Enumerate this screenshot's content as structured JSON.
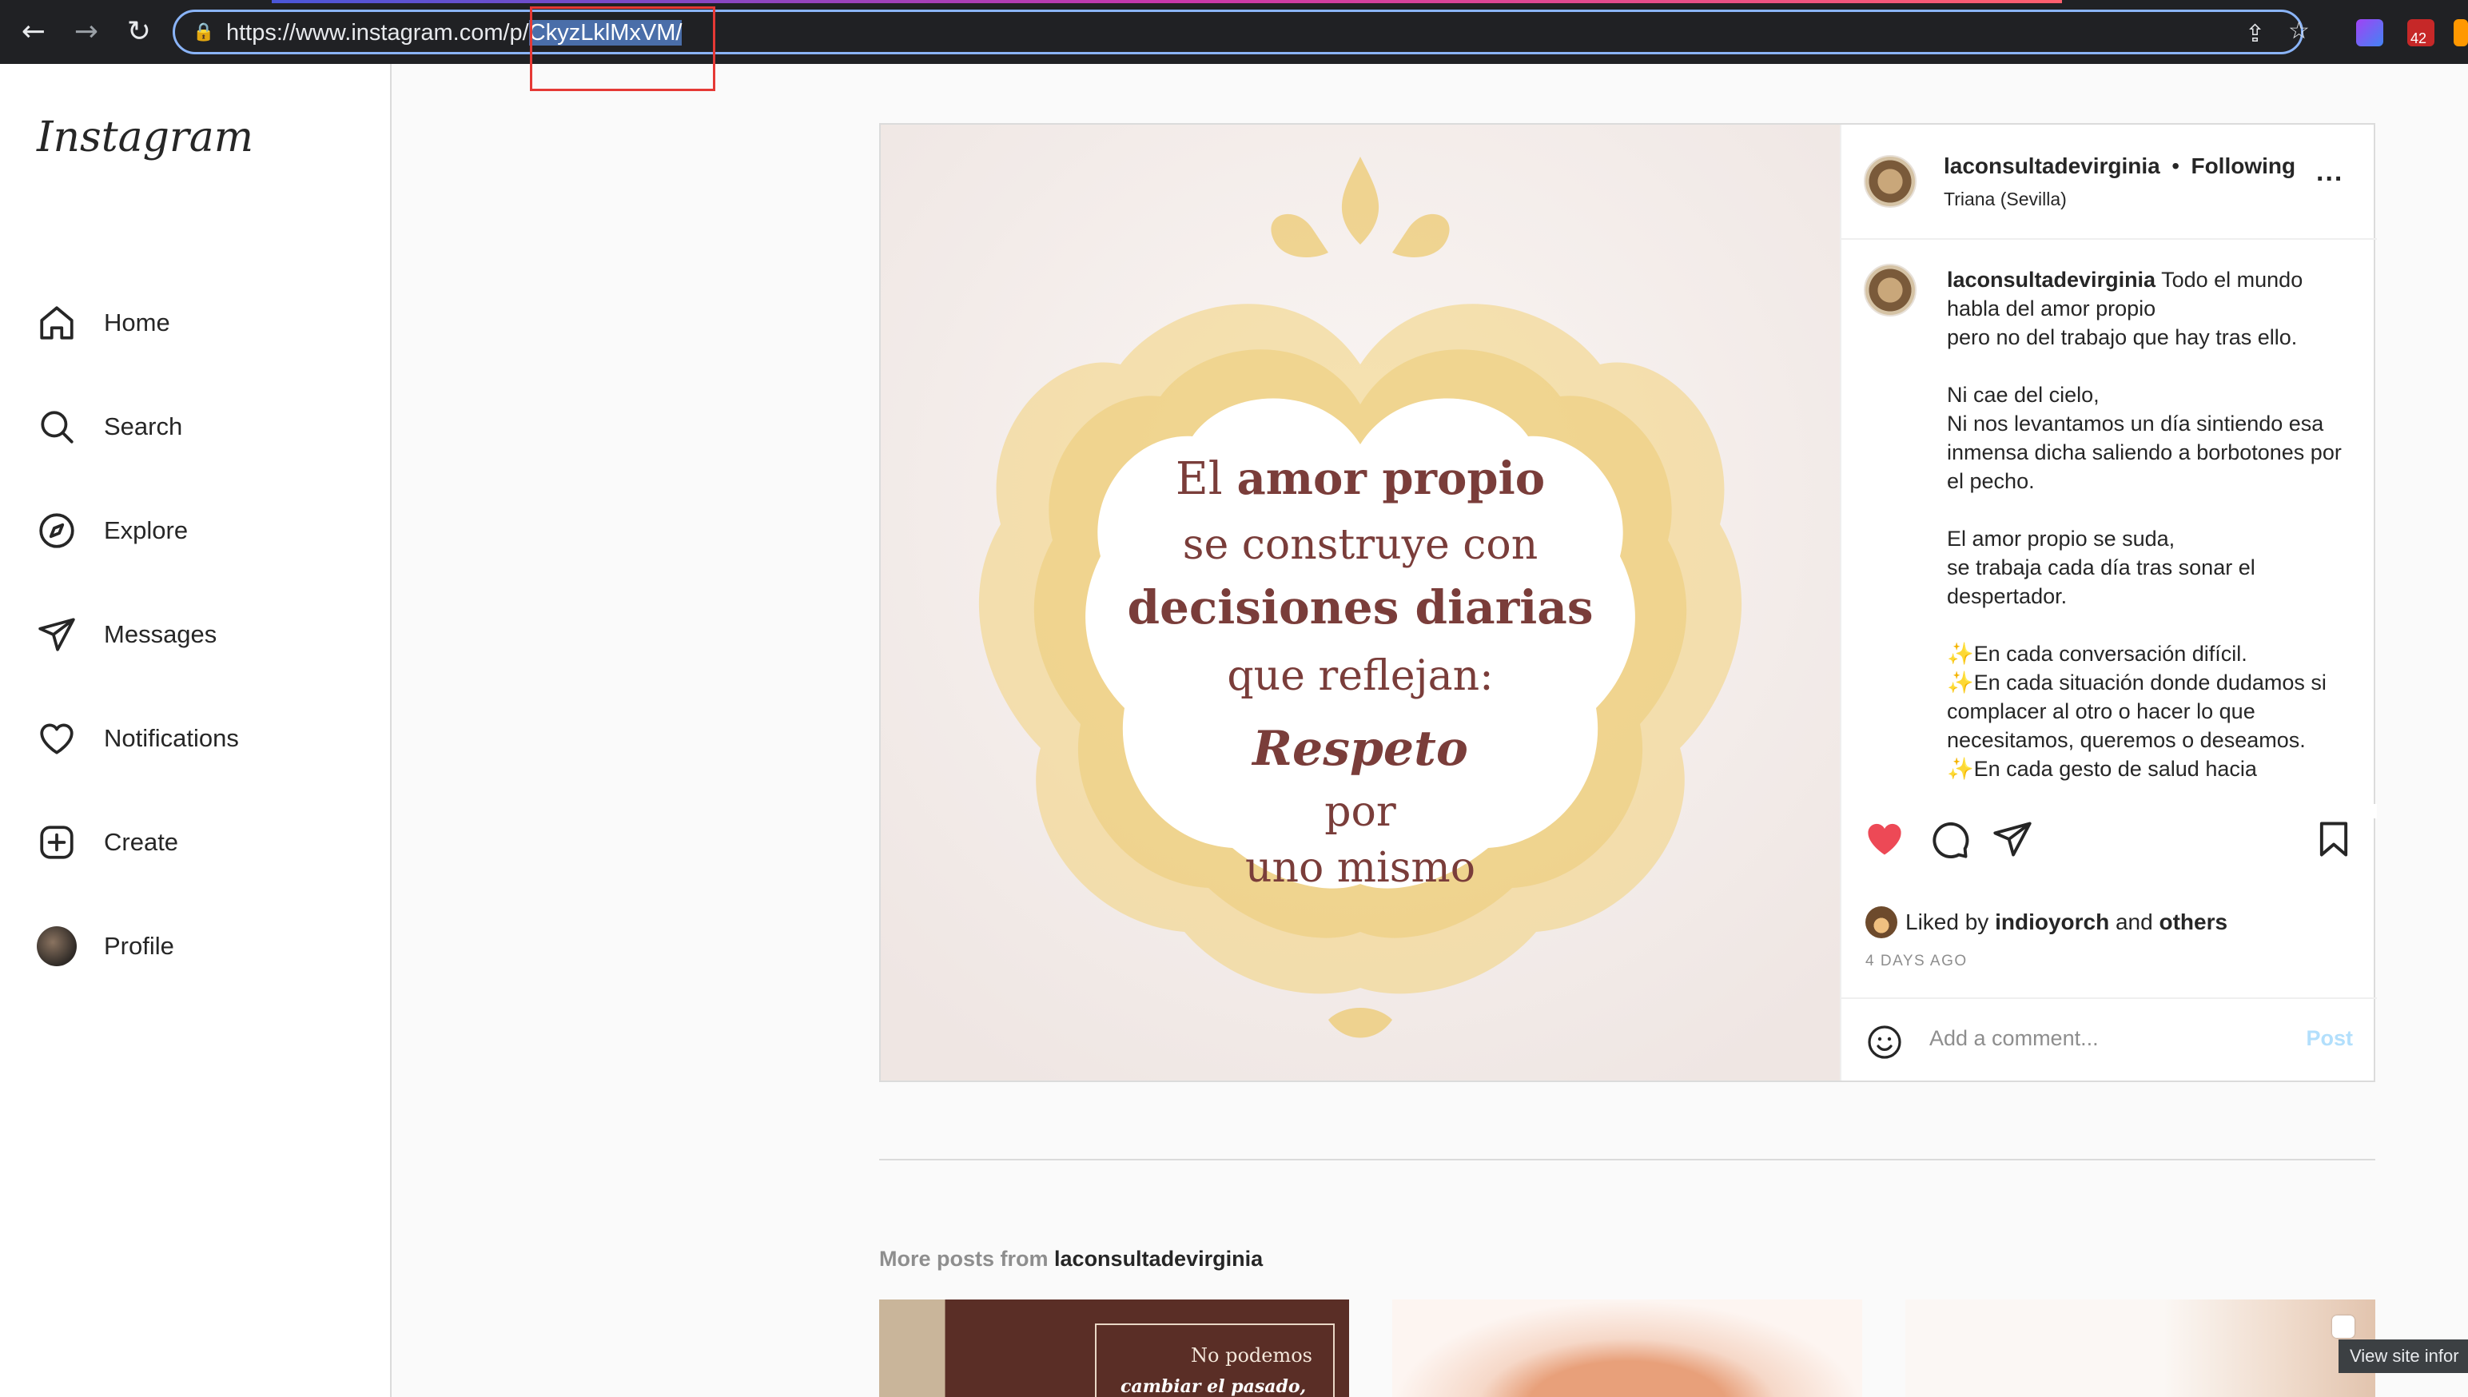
{
  "browser": {
    "url_prefix": "https://www.instagram.com/p/",
    "url_highlight": "CkyzLklMxVM",
    "url_suffix": "/",
    "badge_count": "42"
  },
  "sidebar": {
    "logo": "Instagram",
    "items": [
      {
        "label": "Home",
        "icon": "home-icon"
      },
      {
        "label": "Search",
        "icon": "search-icon"
      },
      {
        "label": "Explore",
        "icon": "compass-icon"
      },
      {
        "label": "Messages",
        "icon": "send-icon"
      },
      {
        "label": "Notifications",
        "icon": "heart-icon"
      },
      {
        "label": "Create",
        "icon": "plus-square-icon"
      },
      {
        "label": "Profile",
        "icon": "avatar"
      }
    ]
  },
  "post": {
    "image_text": {
      "line1_a": "El ",
      "line1_b": "amor propio",
      "line2": "se construye con",
      "line3": "decisiones diarias",
      "line4": "que reflejan:",
      "line5": "Respeto",
      "line6": "por",
      "line7": "uno mismo"
    },
    "header": {
      "username": "laconsultadevirginia",
      "separator": "•",
      "follow_state": "Following",
      "location": "Triana (Sevilla)",
      "more_label": "..."
    },
    "caption": {
      "username": "laconsultadevirginia",
      "first_line": " Todo el mundo habla del amor propio",
      "body": "pero no del trabajo que hay tras ello.\n\nNi cae del cielo,\nNi nos levantamos un día sintiendo esa inmensa dicha saliendo a borbotones por el pecho.\n\nEl amor propio se suda,\nse trabaja cada día tras sonar el despertador.\n\n✨En cada conversación difícil.\n✨En cada situación donde dudamos si complacer al otro o hacer lo que necesitamos, queremos o deseamos.\n✨En cada gesto de salud hacia"
    },
    "likes": {
      "prefix": "Liked by ",
      "user": "indioyorch",
      "middle": " and ",
      "others": "others"
    },
    "date": "4 DAYS AGO",
    "comment": {
      "placeholder": "Add a comment...",
      "post_label": "Post"
    },
    "colors": {
      "like": "#ed4956",
      "post_btn": "#b2dffc"
    }
  },
  "more": {
    "prefix": "More posts from ",
    "username": "laconsultadevirginia",
    "thumb1_line1": "No podemos",
    "thumb1_line2": "cambiar el pasado,"
  },
  "tooltip": "View site infor"
}
